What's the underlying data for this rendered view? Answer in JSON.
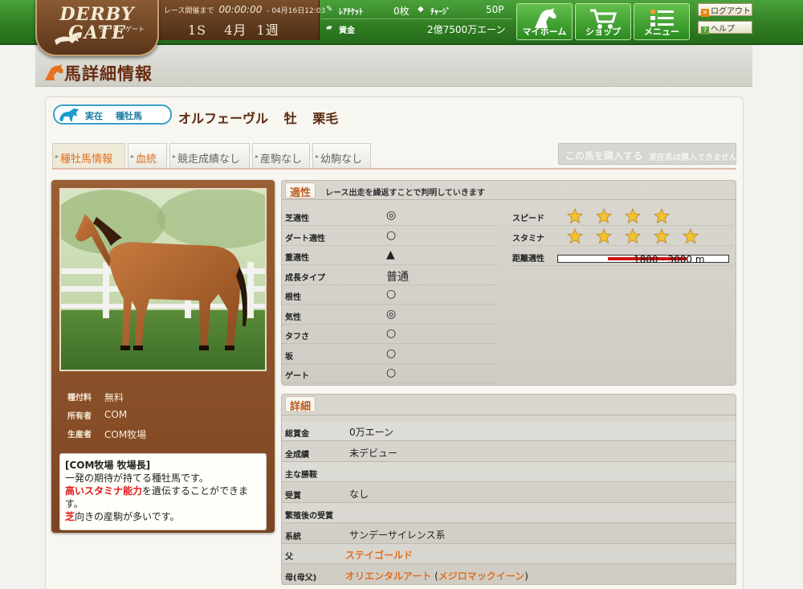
{
  "header": {
    "logo_line1": "DERBY",
    "logo_line2": "GATE",
    "logo_sub": "ダービーゲート",
    "race_label": "レース開催まで",
    "race_timer": "00:00:00",
    "race_datetime": "04月16日12:03",
    "season": "1S",
    "month": "4月",
    "week": "1週",
    "rare_ticket_label": "ﾚｱﾁｹｯﾄ",
    "rare_ticket_value": "0枚",
    "charge_label": "ﾁｬｰｼﾞ",
    "charge_value": "50P",
    "funds_label": "資金",
    "funds_value": "2億7500万エーン",
    "nav": {
      "home": "マイホーム",
      "shop": "ショップ",
      "menu": "メニュー"
    },
    "logout": "ログアウト",
    "help": "ヘルプ"
  },
  "page_title": "馬詳細情報",
  "horse": {
    "category_type": "実在",
    "category_role": "種牡馬",
    "name": "オルフェーヴル",
    "sex": "牡",
    "coat": "栗毛"
  },
  "tabs": [
    {
      "label": "種牡馬情報"
    },
    {
      "label": "血統"
    },
    {
      "label": "競走成績なし"
    },
    {
      "label": "産駒なし"
    },
    {
      "label": "幼駒なし"
    }
  ],
  "buy": {
    "button": "この馬を購入する",
    "note": "実在馬は購入できません"
  },
  "info": [
    {
      "key": "種付料",
      "value": "無料"
    },
    {
      "key": "所有者",
      "value": "COM"
    },
    {
      "key": "生産者",
      "value": "COM牧場"
    }
  ],
  "comment": {
    "head": "[COM牧場 牧場長]",
    "line1": "一発の期待が持てる種牡馬です。",
    "line2_red": "高いスタミナ能力",
    "line2_rest": "を遺伝することができます。",
    "line3_red": "芝",
    "line3_rest": "向きの産駒が多いです。"
  },
  "aptitude": {
    "title": "適性",
    "note": "レース出走を繰返すことで判明していきます",
    "rows": [
      {
        "key": "芝適性",
        "value": "◎"
      },
      {
        "key": "ダート適性",
        "value": "○"
      },
      {
        "key": "重適性",
        "value": "▲"
      },
      {
        "key": "成長タイプ",
        "value": "普通"
      },
      {
        "key": "根性",
        "value": "○"
      },
      {
        "key": "気性",
        "value": "◎"
      },
      {
        "key": "タフさ",
        "value": "○"
      },
      {
        "key": "坂",
        "value": "○"
      },
      {
        "key": "ゲート",
        "value": "○"
      }
    ],
    "speed_label": "スピード",
    "speed_stars": 4,
    "stamina_label": "スタミナ",
    "stamina_stars": 5,
    "distance_label": "距離適性",
    "distance_text": "1800 - 3000 m",
    "star_color": "#f2c230"
  },
  "details": {
    "title": "詳細",
    "rows": [
      {
        "key": "総賞金",
        "value": "0万エーン"
      },
      {
        "key": "全成績",
        "value": "未デビュー"
      },
      {
        "key": "主な勝鞍",
        "value": ""
      },
      {
        "key": "受賞",
        "value": "なし"
      },
      {
        "key": "繁殖後の受賞",
        "value": ""
      },
      {
        "key": "系統",
        "value": "サンデーサイレンス系"
      }
    ],
    "sire_label": "父",
    "sire": "ステイゴールド",
    "dam_label": "母(母父)",
    "dam": "オリエンタルアート",
    "damsire": "メジロマックイーン"
  }
}
